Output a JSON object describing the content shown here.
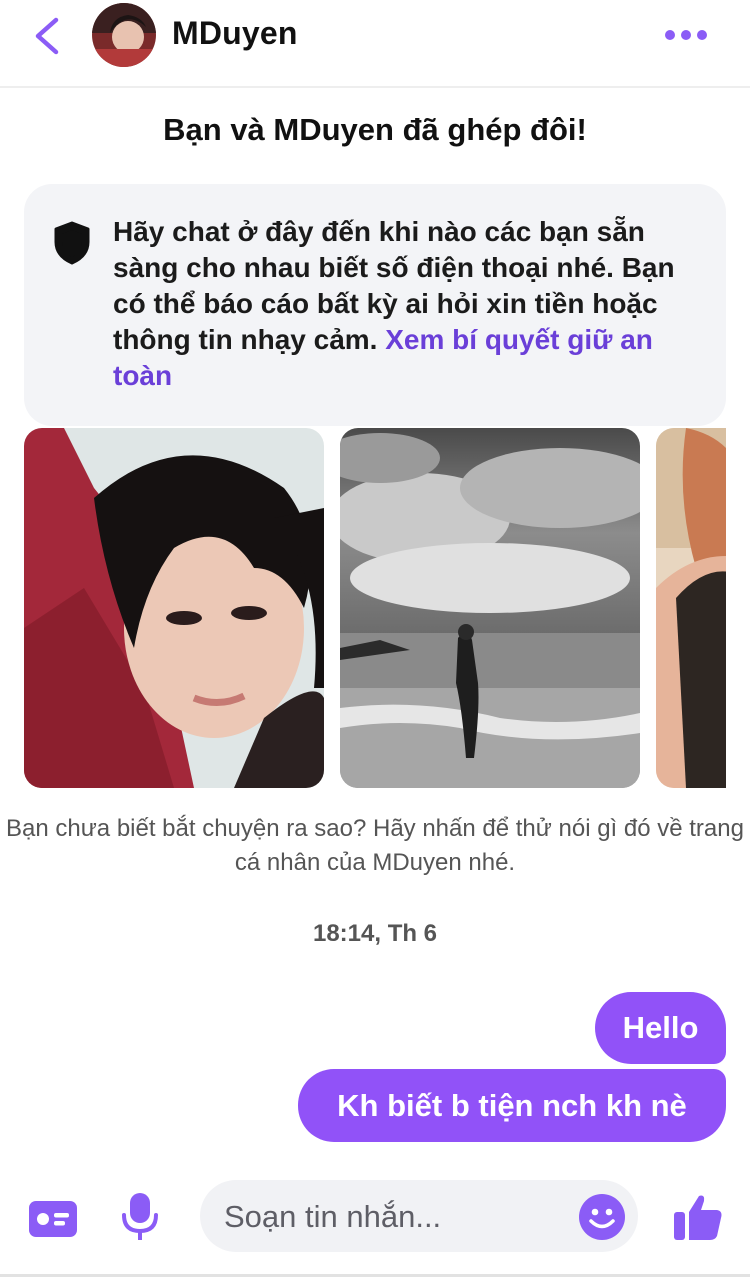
{
  "header": {
    "contact_name": "MDuyen",
    "accent_color": "#8b5cf6",
    "back_icon": "chevron-left-icon",
    "more_icon": "more-horizontal-icon"
  },
  "match": {
    "title": "Bạn và MDuyen đã ghép đôi!"
  },
  "safety": {
    "icon": "shield-icon",
    "text": "Hãy chat ở đây đến khi nào các bạn sẵn sàng cho nhau biết số điện thoại nhé. Bạn có thể báo cáo bất kỳ ai hỏi xin tiền hoặc thông tin nhạy cảm. ",
    "link_text": "Xem bí quyết giữ an toàn",
    "link_color": "#6a3fd8"
  },
  "profile_photos": {
    "count_visible": 3,
    "hint": "Bạn chưa biết bắt chuyện ra sao? Hãy nhấn để thử nói gì đó về trang cá nhân của MDuyen nhé."
  },
  "conversation": {
    "timestamp": "18:14, Th 6",
    "bubble_color": "#9152f8",
    "messages": [
      {
        "sender": "me",
        "text": "Hello"
      },
      {
        "sender": "me",
        "text": "Kh biết b tiện nch kh nè"
      }
    ]
  },
  "composer": {
    "placeholder": "Soạn tin nhắn...",
    "value": "",
    "icons": [
      "id-card-icon",
      "microphone-icon",
      "emoji-icon",
      "thumbs-up-icon"
    ]
  }
}
